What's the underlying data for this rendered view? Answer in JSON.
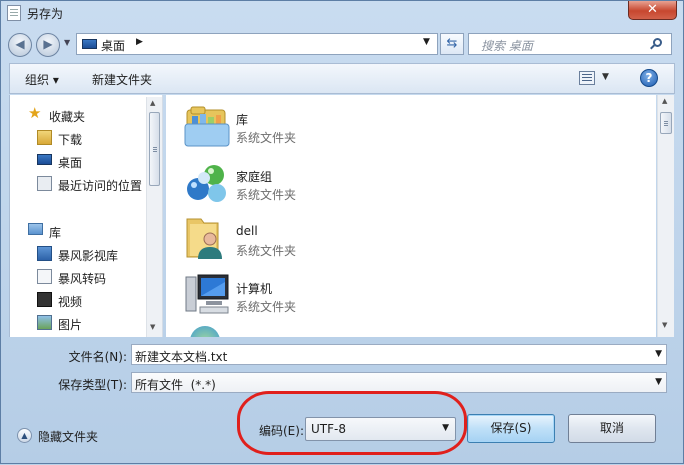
{
  "window": {
    "title": "另存为",
    "close": "✕"
  },
  "address": {
    "location": "桌面",
    "search_placeholder": "搜索 桌面"
  },
  "toolbar": {
    "organize": "组织 ▾",
    "new_folder": "新建文件夹",
    "help": "?"
  },
  "sidebar": {
    "favorites_header": "收藏夹",
    "favorites": [
      "下载",
      "桌面",
      "最近访问的位置"
    ],
    "library_header": "库",
    "libraries": [
      "暴风影视库",
      "暴风转码",
      "视频",
      "图片"
    ]
  },
  "files": [
    {
      "name": "库",
      "type": "系统文件夹",
      "icon": "library-icon"
    },
    {
      "name": "家庭组",
      "type": "系统文件夹",
      "icon": "homegroup-icon"
    },
    {
      "name": "dell",
      "type": "系统文件夹",
      "icon": "user-folder-icon"
    },
    {
      "name": "计算机",
      "type": "系统文件夹",
      "icon": "computer-icon"
    }
  ],
  "form": {
    "filename_label": "文件名(N):",
    "filename_value": "新建文本文档.txt",
    "type_label": "保存类型(T):",
    "type_value": "所有文件  (*.*)",
    "encoding_label": "编码(E):",
    "encoding_value": "UTF-8",
    "hide_folders": "隐藏文件夹",
    "save": "保存(S)",
    "cancel": "取消"
  },
  "colors": {
    "annotation_circle": "#e0201c",
    "accent": "#3466a8"
  }
}
